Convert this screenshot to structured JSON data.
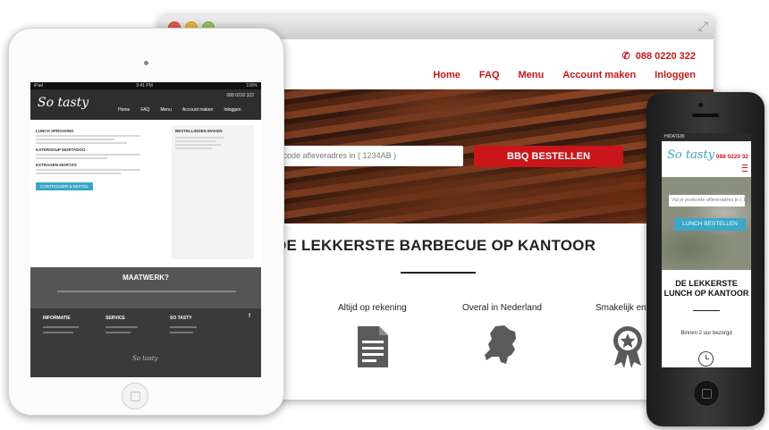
{
  "desktop": {
    "phone_number": "088 0220 322",
    "nav": [
      "Home",
      "FAQ",
      "Menu",
      "Account maken",
      "Inloggen"
    ],
    "search": {
      "placeholder": "tcode afleveradres in ( 1234AB )"
    },
    "order_button": "BBQ BESTELLEN",
    "headline": "DE LEKKERSTE BARBECUE OP KANTOOR",
    "features": [
      {
        "label": "Altijd op rekening",
        "icon": "document-icon"
      },
      {
        "label": "Overal in Nederland",
        "icon": "netherlands-map-icon"
      },
      {
        "label": "Smakelijk en v",
        "icon": "award-badge-icon"
      }
    ]
  },
  "tablet": {
    "status_left": "iPad",
    "status_center": "9:41 PM",
    "status_right": "100%",
    "logo": "So tasty",
    "phone": "088 0220 322",
    "nav": [
      "Home",
      "FAQ",
      "Menu",
      "Account maken",
      "Inloggen"
    ],
    "sections": [
      "LUNCH SPROOIING",
      "KATERSOUP MORTADOO",
      "EXTRAGEN MORTZO"
    ],
    "checkout_button": "CONTROLEER & BESTEL",
    "side_title": "BESTELLINGEN MAKEN",
    "maatwerk": "MAATWERK?",
    "footer_cols": [
      "INFORMATIE",
      "SERVICE",
      "SO TASTY"
    ],
    "footer_social": "f",
    "footer_logo": "So tasty"
  },
  "phone": {
    "carrier": "HIDATEBI",
    "logo": "So tasty",
    "phone_number": "088 0220 32",
    "search_placeholder": "Vul je postcode afleveradres in ( 1234AB )",
    "lunch_button": "LUNCH BESTELLEN",
    "title": "DE LEKKERSTE LUNCH OP KANTOOR",
    "feature": "Binnen 2 uur bezorgd"
  },
  "colors": {
    "accent_red": "#c8161b",
    "accent_blue": "#3aa6c8"
  }
}
